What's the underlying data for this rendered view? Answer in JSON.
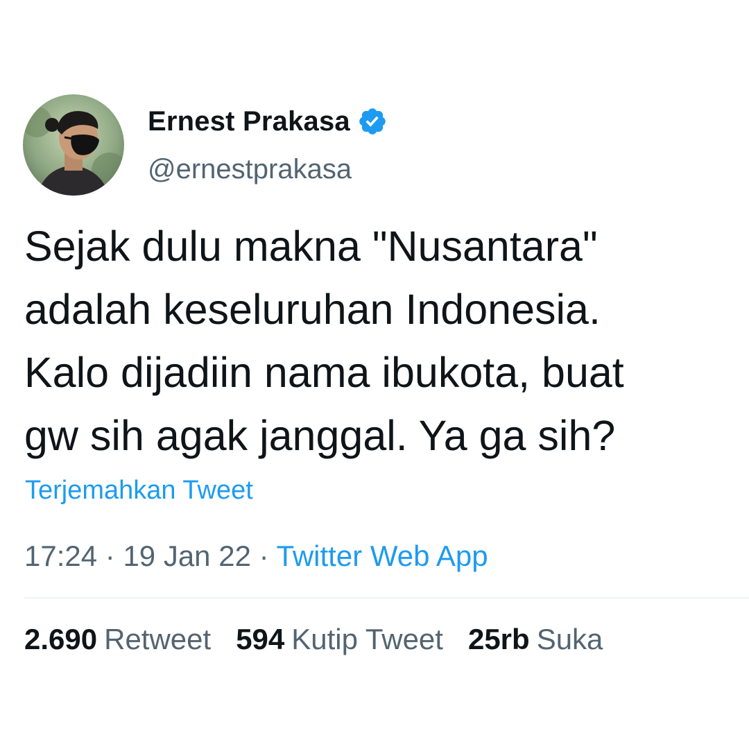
{
  "author": {
    "display_name": "Ernest Prakasa",
    "handle": "@ernestprakasa",
    "verified": true
  },
  "tweet": {
    "text_lines": [
      "Sejak dulu makna \"Nusantara\"",
      "adalah keseluruhan Indonesia.",
      "Kalo dijadiin nama ibukota, buat",
      "gw sih agak janggal. Ya ga sih?"
    ],
    "translate_label": "Terjemahkan Tweet"
  },
  "meta": {
    "time": "17:24",
    "separator": " · ",
    "date": "19 Jan 22",
    "source": "Twitter Web App"
  },
  "stats": {
    "retweets": {
      "count": "2.690",
      "label": "Retweet"
    },
    "quotes": {
      "count": "594",
      "label": "Kutip Tweet"
    },
    "likes": {
      "count": "25rb",
      "label": "Suka"
    }
  },
  "colors": {
    "text_primary": "#0f1419",
    "text_secondary": "#536471",
    "accent": "#1d9bf0",
    "divider": "#eff3f4"
  }
}
